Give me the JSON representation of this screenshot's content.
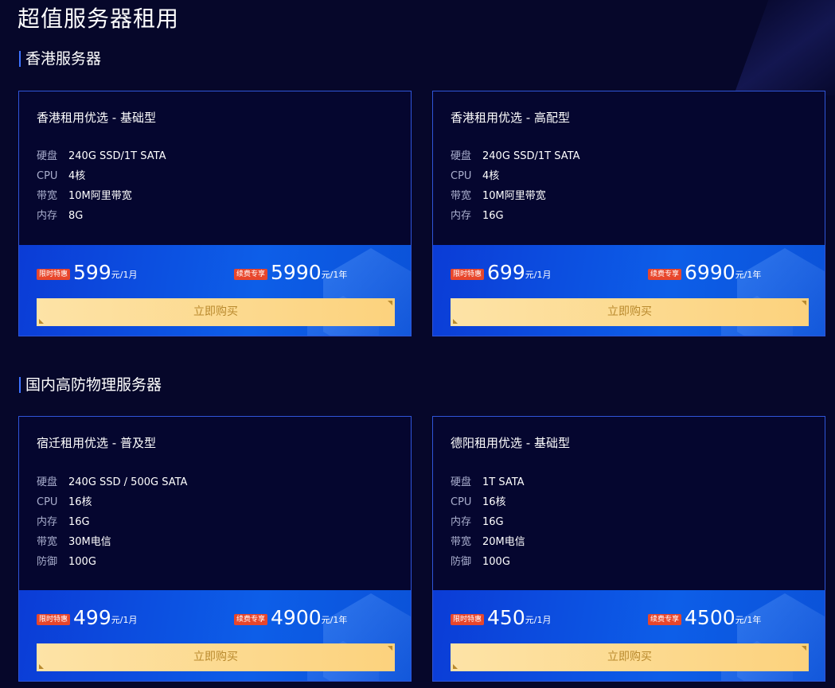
{
  "page": {
    "title": "超值服务器租用"
  },
  "sections": [
    {
      "title": "香港服务器",
      "cards": [
        {
          "title": "香港租用优选 - 基础型",
          "specs": [
            {
              "label": "硬盘",
              "value": "240G SSD/1T SATA"
            },
            {
              "label": "CPU",
              "value": "4核"
            },
            {
              "label": "带宽",
              "value": "10M阿里带宽"
            },
            {
              "label": "内存",
              "value": "8G"
            }
          ],
          "monthly": {
            "badge": "限时特惠",
            "price": "599",
            "unit": "元/1月"
          },
          "yearly": {
            "badge": "续费专享",
            "price": "5990",
            "unit": "元/1年"
          },
          "buy_label": "立即购买"
        },
        {
          "title": "香港租用优选 - 高配型",
          "specs": [
            {
              "label": "硬盘",
              "value": "240G SSD/1T SATA"
            },
            {
              "label": "CPU",
              "value": "4核"
            },
            {
              "label": "带宽",
              "value": "10M阿里带宽"
            },
            {
              "label": "内存",
              "value": "16G"
            }
          ],
          "monthly": {
            "badge": "限时特惠",
            "price": "699",
            "unit": "元/1月"
          },
          "yearly": {
            "badge": "续费专享",
            "price": "6990",
            "unit": "元/1年"
          },
          "buy_label": "立即购买"
        }
      ]
    },
    {
      "title": "国内高防物理服务器",
      "cards": [
        {
          "title": "宿迁租用优选 - 普及型",
          "specs": [
            {
              "label": "硬盘",
              "value": "240G SSD / 500G SATA"
            },
            {
              "label": "CPU",
              "value": "16核"
            },
            {
              "label": "内存",
              "value": "16G"
            },
            {
              "label": "带宽",
              "value": "30M电信"
            },
            {
              "label": "防御",
              "value": "100G"
            }
          ],
          "monthly": {
            "badge": "限时特惠",
            "price": "499",
            "unit": "元/1月"
          },
          "yearly": {
            "badge": "续费专享",
            "price": "4900",
            "unit": "元/1年"
          },
          "buy_label": "立即购买"
        },
        {
          "title": "德阳租用优选 - 基础型",
          "specs": [
            {
              "label": "硬盘",
              "value": "1T SATA"
            },
            {
              "label": "CPU",
              "value": "16核"
            },
            {
              "label": "内存",
              "value": "16G"
            },
            {
              "label": "带宽",
              "value": "20M电信"
            },
            {
              "label": "防御",
              "value": "100G"
            }
          ],
          "monthly": {
            "badge": "限时特惠",
            "price": "450",
            "unit": "元/1月"
          },
          "yearly": {
            "badge": "续费专享",
            "price": "4500",
            "unit": "元/1年"
          },
          "buy_label": "立即购买"
        }
      ]
    }
  ],
  "colors": {
    "background": "#06072a",
    "card_border": "#2f55d8",
    "price_bg": "#0d5ee8",
    "badge": "#e8462b",
    "button_bg": "#fcd27d",
    "button_text": "#b98a2e",
    "section_bar": "#3d72ff"
  }
}
